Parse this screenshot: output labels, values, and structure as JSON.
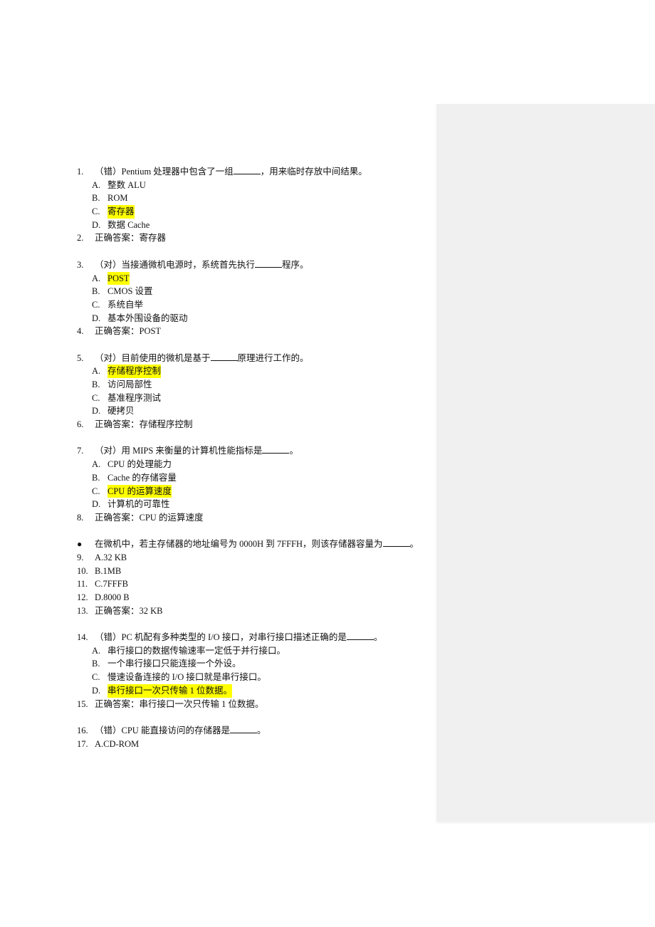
{
  "colors": {
    "highlight": "#ffff00",
    "comment_pane": "#f0f0f0"
  },
  "blocks": [
    {
      "num": "1.",
      "prefix": "（错）Pentium 处理器中包含了一组",
      "suffix": "，用来临时存放中间结果。",
      "options": [
        {
          "letter": "A.",
          "text": "整数 ALU",
          "highlighted": false
        },
        {
          "letter": "B.",
          "text": "ROM",
          "highlighted": false
        },
        {
          "letter": "C.",
          "text": "寄存器",
          "highlighted": true
        },
        {
          "letter": "D.",
          "text": "数据 Cache",
          "highlighted": false
        }
      ],
      "answer_num": "2.",
      "answer": "正确答案：寄存器"
    },
    {
      "num": "3.",
      "prefix": "（对）当接通微机电源时，系统首先执行",
      "suffix": "程序。",
      "options": [
        {
          "letter": "A.",
          "text": "POST",
          "highlighted": true
        },
        {
          "letter": "B.",
          "text": "CMOS 设置",
          "highlighted": false
        },
        {
          "letter": "C.",
          "text": "系统自举",
          "highlighted": false
        },
        {
          "letter": "D.",
          "text": "基本外围设备的驱动",
          "highlighted": false
        }
      ],
      "answer_num": "4.",
      "answer": "正确答案：POST"
    },
    {
      "num": "5.",
      "prefix": "（对）目前使用的微机是基于",
      "suffix": "原理进行工作的。",
      "options": [
        {
          "letter": "A.",
          "text": "存储程序控制",
          "highlighted": true
        },
        {
          "letter": "B.",
          "text": "访问局部性",
          "highlighted": false
        },
        {
          "letter": "C.",
          "text": "基准程序测试",
          "highlighted": false
        },
        {
          "letter": "D.",
          "text": "硬拷贝",
          "highlighted": false
        }
      ],
      "answer_num": "6.",
      "answer": "正确答案：存储程序控制"
    },
    {
      "num": "7.",
      "prefix": "（对）用 MIPS 来衡量的计算机性能指标是",
      "suffix": "。",
      "options": [
        {
          "letter": "A.",
          "text": "CPU 的处理能力",
          "highlighted": false
        },
        {
          "letter": "B.",
          "text": "Cache 的存储容量",
          "highlighted": false
        },
        {
          "letter": "C.",
          "text": "CPU 的运算速度",
          "highlighted": true
        },
        {
          "letter": "D.",
          "text": "计算机的可靠性",
          "highlighted": false
        }
      ],
      "answer_num": "8.",
      "answer": "正确答案：CPU 的运算速度"
    }
  ],
  "bullet_question": {
    "bullet": "●",
    "prefix": "在微机中，若主存储器的地址编号为 0000H 到 7FFFH，则该存储器容量为",
    "suffix": "。",
    "items": [
      {
        "num": "9.",
        "text": "A.32 KB"
      },
      {
        "num": "10.",
        "text": "B.1MB"
      },
      {
        "num": "11.",
        "text": "C.7FFFB"
      },
      {
        "num": "12.",
        "text": "D.8000 B"
      },
      {
        "num": "13.",
        "text": "正确答案：32 KB"
      }
    ]
  },
  "block14": {
    "num": "14.",
    "prefix": "（错）PC 机配有多种类型的 I/O 接口，对串行接口描述正确的是",
    "suffix": "。",
    "options": [
      {
        "letter": "A.",
        "text": "串行接口的数据传输速率一定低于并行接口。",
        "highlighted": false
      },
      {
        "letter": "B.",
        "text": "一个串行接口只能连接一个外设。",
        "highlighted": false
      },
      {
        "letter": "C.",
        "text": "慢速设备连接的 I/O 接口就是串行接口。",
        "highlighted": false
      },
      {
        "letter": "D.",
        "text": "串行接口一次只传输 1 位数据。",
        "highlighted": true
      }
    ],
    "answer_num": "15.",
    "answer": "正确答案：串行接口一次只传输 1 位数据。"
  },
  "block16": {
    "num": "16.",
    "prefix": "（错）CPU 能直接访问的存储器是",
    "suffix": "。",
    "items": [
      {
        "num": "17.",
        "text": "A.CD-ROM"
      }
    ]
  }
}
